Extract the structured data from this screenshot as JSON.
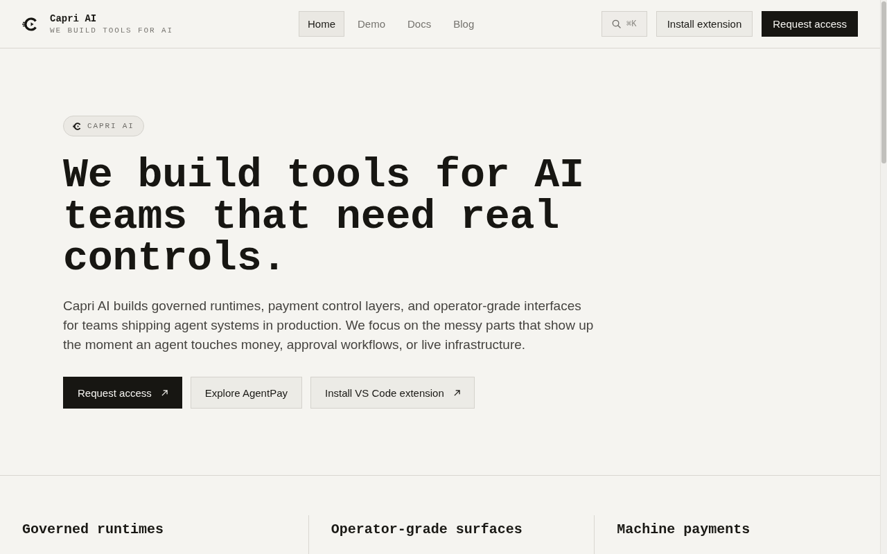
{
  "header": {
    "brand": {
      "name": "Capri AI",
      "tagline": "WE BUILD TOOLS FOR AI"
    },
    "nav": [
      {
        "label": "Home",
        "selected": true
      },
      {
        "label": "Demo",
        "selected": false
      },
      {
        "label": "Docs",
        "selected": false
      },
      {
        "label": "Blog",
        "selected": false
      }
    ],
    "search": {
      "shortcut": "⌘K"
    },
    "buttons": [
      {
        "label": "Install extension",
        "kind": "secondary"
      },
      {
        "label": "Request access",
        "kind": "primary"
      }
    ]
  },
  "hero": {
    "badge": "CAPRI AI",
    "heading": "We build tools for AI teams that need real controls.",
    "description": "Capri AI builds governed runtimes, payment control layers, and operator-grade interfaces for teams shipping agent systems in production. We focus on the messy parts that show up the moment an agent touches money, approval workflows, or live infrastructure.",
    "actions": [
      {
        "label": "Request access",
        "kind": "primary",
        "external": true
      },
      {
        "label": "Explore AgentPay",
        "kind": "secondary",
        "external": false
      },
      {
        "label": "Install VS Code extension",
        "kind": "secondary",
        "external": true
      }
    ]
  },
  "features": [
    {
      "title": "Governed runtimes"
    },
    {
      "title": "Operator-grade surfaces"
    },
    {
      "title": "Machine payments"
    }
  ]
}
